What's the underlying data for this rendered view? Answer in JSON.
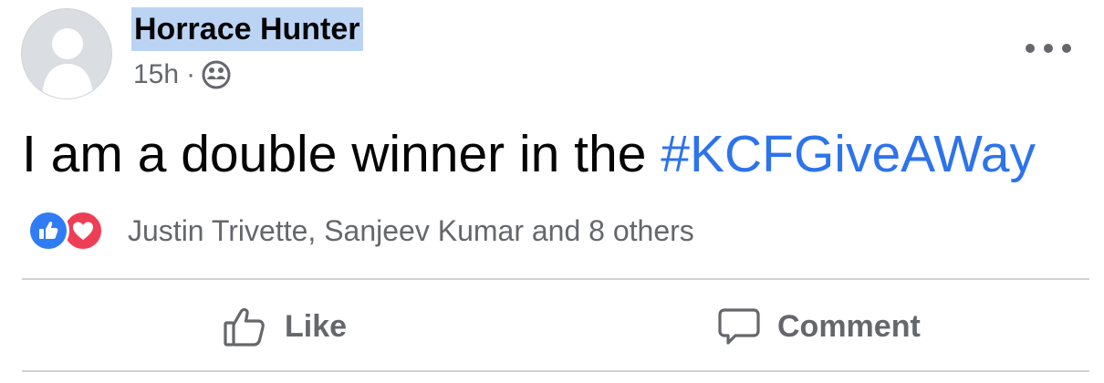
{
  "post": {
    "author": "Horrace Hunter",
    "time": "15h",
    "separator": "·",
    "audience_icon": "friends-icon",
    "text_prefix": "I am a double winner in the ",
    "hashtag": "#KCFGiveAWay",
    "reactions": {
      "icons": [
        "like-icon",
        "love-icon"
      ],
      "summary": "Justin Trivette, Sanjeev Kumar and 8 others"
    },
    "actions": {
      "like_label": "Like",
      "comment_label": "Comment"
    },
    "more_icon": "more-options-icon"
  },
  "colors": {
    "hashtag": "#2d73ec",
    "name_highlight": "#bcd4f4",
    "secondary_text": "#65676b",
    "like_blue": "#2f7cf5",
    "love_red": "#ee3e55"
  }
}
